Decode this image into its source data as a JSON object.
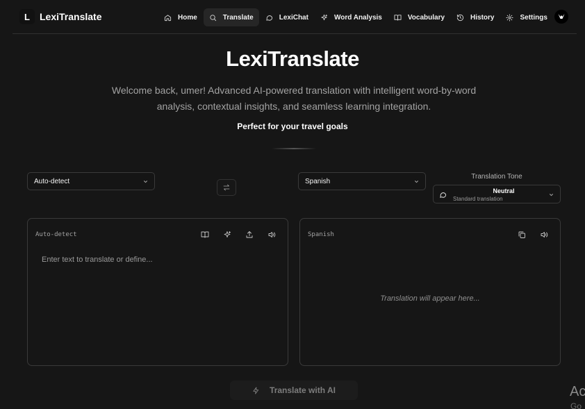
{
  "brand": {
    "mark": "L",
    "name": "LexiTranslate"
  },
  "nav": {
    "items": [
      {
        "label": "Home",
        "icon": "home-icon",
        "active": false
      },
      {
        "label": "Translate",
        "icon": "search-icon",
        "active": true
      },
      {
        "label": "LexiChat",
        "icon": "chat-icon",
        "active": false
      },
      {
        "label": "Word Analysis",
        "icon": "sparkles-icon",
        "active": false
      },
      {
        "label": "Vocabulary",
        "icon": "book-icon",
        "active": false
      },
      {
        "label": "History",
        "icon": "history-icon",
        "active": false
      },
      {
        "label": "Settings",
        "icon": "gear-icon",
        "active": false
      }
    ]
  },
  "hero": {
    "title": "LexiTranslate",
    "subtitle": "Welcome back, umer! Advanced AI-powered translation with intelligent word-by-word analysis, contextual insights, and seamless learning integration.",
    "goal": "Perfect for your travel goals"
  },
  "languages": {
    "source": "Auto-detect",
    "target": "Spanish"
  },
  "tone": {
    "label": "Translation Tone",
    "value": "Neutral",
    "description": "Standard translation"
  },
  "input_panel": {
    "label": "Auto-detect",
    "placeholder": "Enter text to translate or define..."
  },
  "output_panel": {
    "label": "Spanish",
    "placeholder": "Translation will appear here..."
  },
  "translate_button": "Translate with AI",
  "watermark": {
    "line1": "Ac",
    "line2": "Go"
  },
  "colors": {
    "background": "#161616",
    "border": "#3a3a3a",
    "text": "#fafafa",
    "muted": "#a3a3a3"
  }
}
